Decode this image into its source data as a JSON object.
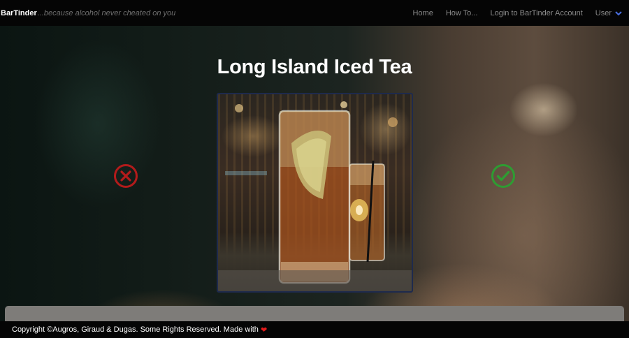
{
  "navbar": {
    "brand": "BarTinder",
    "tagline": "...because alcohol never cheated on you",
    "links": {
      "home": "Home",
      "how_to": "How To...",
      "login": "Login to BarTinder Account",
      "user": "User"
    },
    "user_icon": "chevron-down-icon",
    "accent_color": "#4a6fe0"
  },
  "main": {
    "drink_title": "Long Island Iced Tea",
    "reject_icon": "x-circle-icon",
    "accept_icon": "check-circle-icon",
    "reject_color": "#b31b1b",
    "accept_color": "#2e9c32"
  },
  "footer": {
    "text": "Copyright ©Augros, Giraud & Dugas. Some Rights Reserved. Made with",
    "heart": "❤"
  }
}
